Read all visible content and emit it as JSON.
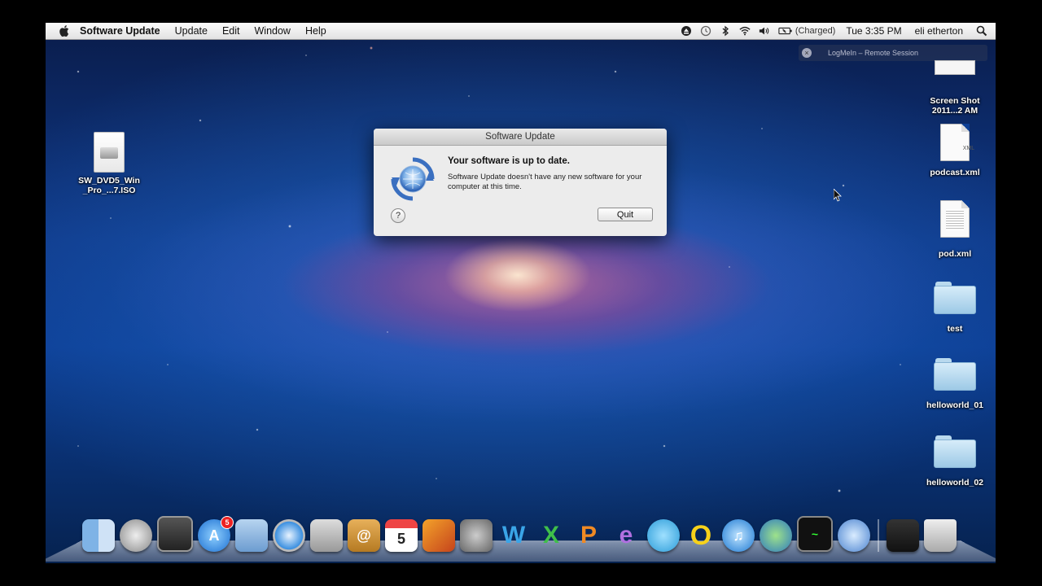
{
  "menubar": {
    "app_name": "Software Update",
    "menus": [
      "Update",
      "Edit",
      "Window",
      "Help"
    ],
    "battery_status": "(Charged)",
    "clock": "Tue 3:35 PM",
    "user": "eli etherton",
    "icons": [
      "apple-logo",
      "eject-icon",
      "time-machine-icon",
      "bluetooth-icon",
      "wifi-icon",
      "volume-icon",
      "battery-icon",
      "spotlight-search-icon"
    ]
  },
  "logmein": {
    "label": "LogMeIn – Remote Session"
  },
  "desktop_icons": {
    "iso": {
      "label": "SW_DVD5_Win_Pro_...7.ISO"
    },
    "screenshot": {
      "label": "Screen Shot 2011...2 AM"
    },
    "podcast": {
      "label": "podcast.xml",
      "tag": "XML"
    },
    "pod": {
      "label": "pod.xml"
    },
    "test": {
      "label": "test"
    },
    "helloworld1": {
      "label": "helloworld_01"
    },
    "helloworld2": {
      "label": "helloworld_02"
    }
  },
  "dialog": {
    "title": "Software Update",
    "heading": "Your software is up to date.",
    "message": "Software Update doesn't have any new software for your computer at this time.",
    "help_label": "?",
    "quit_label": "Quit"
  },
  "dock": {
    "calendar_day": "5",
    "app_store_badge": "5",
    "items": [
      "finder",
      "launchpad",
      "mission-control",
      "app-store",
      "mail",
      "safari",
      "facetime",
      "address-book",
      "ical",
      "iphoto",
      "system-preferences",
      "word",
      "excel",
      "powerpoint",
      "entourage",
      "messenger",
      "opera",
      "itunes",
      "network-utility",
      "activity-monitor",
      "software-update",
      "downloads-stack",
      "trash"
    ]
  },
  "colors": {
    "menubar": "#e8e8e8",
    "dialog_bg": "#ececec",
    "desktop_blue": "#0d3f95"
  }
}
